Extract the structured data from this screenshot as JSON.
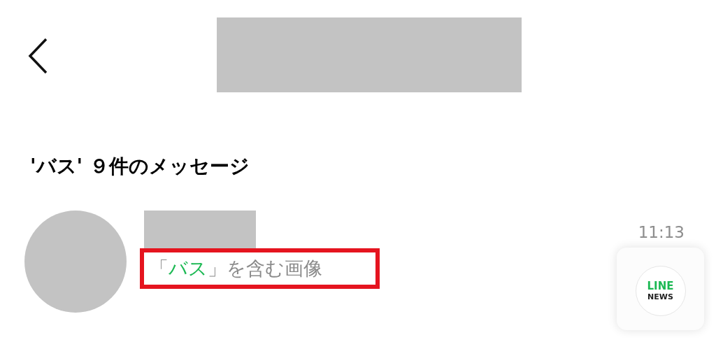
{
  "results_heading": "'バス' ９件のメッセージ",
  "results": [
    {
      "snippet": {
        "prefix": "「",
        "match": "バス",
        "suffix": "」を含む画像"
      },
      "highlighted": true,
      "time": "11:13",
      "thumbnail": {
        "line1": "LINE",
        "line2": "NEWS"
      }
    }
  ]
}
